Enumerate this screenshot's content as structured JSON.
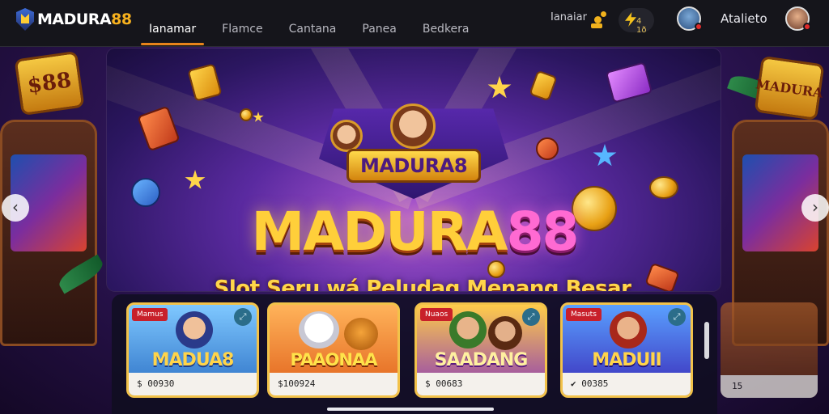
{
  "header": {
    "logo_main": "MADURA",
    "logo_accent": "88",
    "nav": [
      {
        "label": "Ianamar",
        "active": true
      },
      {
        "label": "Flamce",
        "active": false
      },
      {
        "label": "Cantana",
        "active": false
      },
      {
        "label": "Panea",
        "active": false
      },
      {
        "label": "Bedkera",
        "active": false
      }
    ],
    "link_label": "Ianaiar",
    "bolt_value": "4 1ð",
    "username": "Atalieto"
  },
  "banner": {
    "crest_title": "MADURA8",
    "title_main": "MADURA",
    "title_accent": "88",
    "subtitle": "Slot Seru wá Peludag Menang Besar",
    "slides": 3,
    "active_slide": 1
  },
  "cards": [
    {
      "tag": "Mamus",
      "title": "MADUA8",
      "footer": "$ 00930"
    },
    {
      "tag": "",
      "title": "PAAONAA",
      "footer": "$100924"
    },
    {
      "tag": "Nuaos",
      "title": "SAADANG",
      "footer": "$ 00683"
    },
    {
      "tag": "Masuts",
      "title": "MADUII",
      "footer": "✔ 00385"
    },
    {
      "tag": "",
      "title": "",
      "footer": "15"
    }
  ],
  "icons": {
    "prev": "chevron-left-icon",
    "next": "chevron-right-icon",
    "fullscreen": "fullscreen-icon",
    "bolt": "bolt-icon",
    "coins": "coins-icon"
  },
  "colors": {
    "accent": "#e8841a",
    "gold": "#ffcf3a",
    "pink": "#ff6ad2",
    "header_bg": "#15151b"
  }
}
